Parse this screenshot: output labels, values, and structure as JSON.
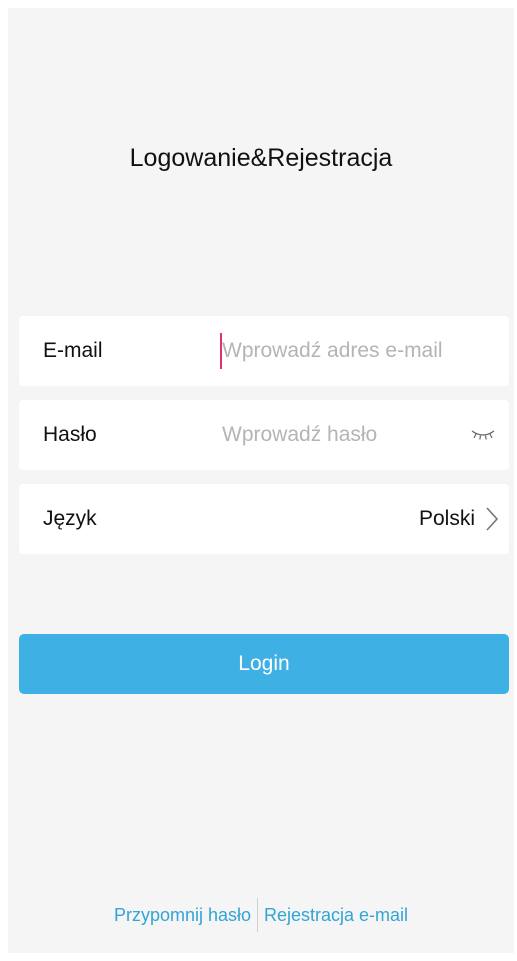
{
  "app": {
    "title": "Logowanie&Rejestracja"
  },
  "form": {
    "email": {
      "label": "E-mail",
      "value": "",
      "placeholder": "Wprowadź adres e-mail"
    },
    "password": {
      "label": "Hasło",
      "value": "",
      "placeholder": "Wprowadź hasło",
      "visibility_icon": "eye-closed-icon"
    },
    "language": {
      "label": "Język",
      "value": "Polski",
      "icon": "chevron-right-icon"
    }
  },
  "actions": {
    "login_label": "Login"
  },
  "footer": {
    "forgot_password": "Przypomnij hasło",
    "register_email": "Rejestracja e-mail"
  },
  "colors": {
    "background": "#f5f5f5",
    "accent": "#3fb0e4",
    "link": "#33a4d6",
    "caret": "#e3306f"
  }
}
